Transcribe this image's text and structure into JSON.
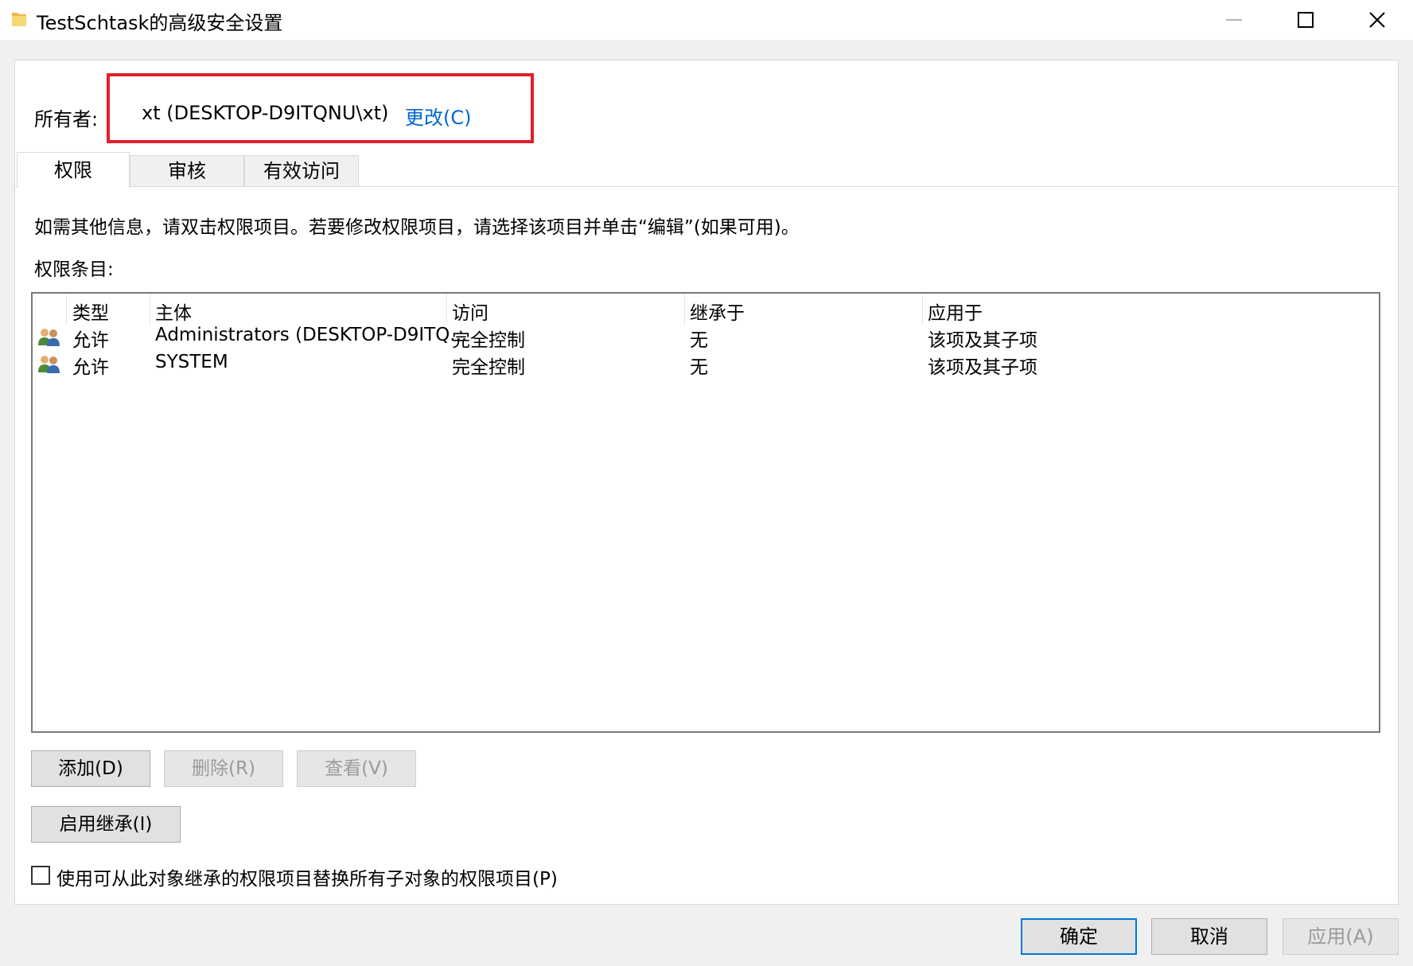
{
  "window": {
    "title": "TestSchtask的高级安全设置",
    "icon": "folder-icon",
    "controls": [
      "minimize-icon",
      "maximize-icon",
      "close-icon"
    ]
  },
  "owner": {
    "label": "所有者:",
    "value": "xt (DESKTOP-D9ITQNU\\xt)",
    "change_link": "更改(C)",
    "highlight_color": "#e0202a"
  },
  "tabs": [
    {
      "label": "权限",
      "active": true
    },
    {
      "label": "审核",
      "active": false
    },
    {
      "label": "有效访问",
      "active": false
    }
  ],
  "permissions": {
    "instructions": "如需其他信息，请双击权限项目。若要修改权限项目，请选择该项目并单击“编辑”(如果可用)。",
    "list_label": "权限条目:",
    "columns": [
      "类型",
      "主体",
      "访问",
      "继承于",
      "应用于"
    ],
    "rows": [
      {
        "icon": "users-icon",
        "type": "允许",
        "principal": "Administrators (DESKTOP-D9ITQ...",
        "access": "完全控制",
        "inherited_from": "无",
        "applies_to": "该项及其子项"
      },
      {
        "icon": "users-icon",
        "type": "允许",
        "principal": "SYSTEM",
        "access": "完全控制",
        "inherited_from": "无",
        "applies_to": "该项及其子项"
      }
    ],
    "buttons": {
      "add": "添加(D)",
      "remove": "删除(R)",
      "view": "查看(V)",
      "enable_inheritance": "启用继承(I)"
    },
    "replace_checkbox_label": "使用可从此对象继承的权限项目替换所有子对象的权限项目(P)",
    "replace_checked": false
  },
  "dialog_buttons": {
    "ok": "确定",
    "cancel": "取消",
    "apply": "应用(A)"
  },
  "colors": {
    "link": "#0066cc",
    "primary_border": "#0078d7",
    "disabled_text": "#9a9a9a"
  }
}
